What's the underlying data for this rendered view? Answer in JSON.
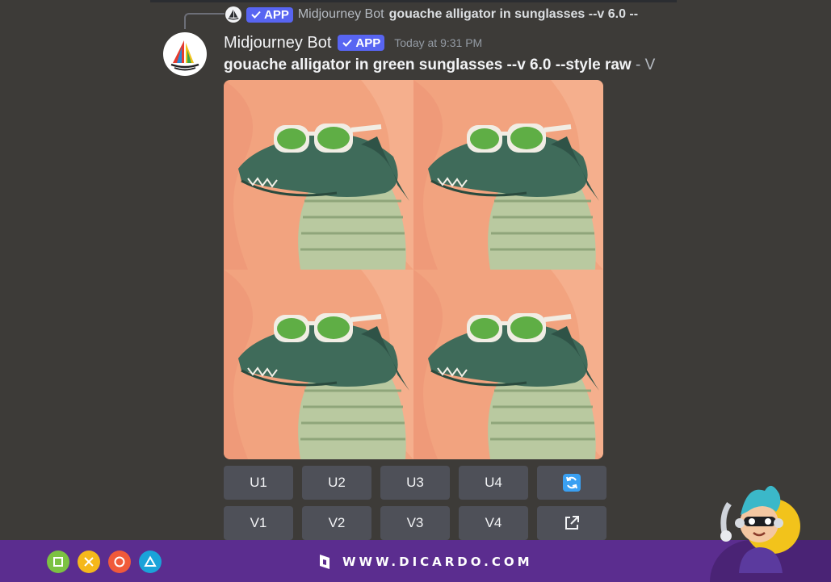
{
  "reply": {
    "bot_name": "Midjourney Bot",
    "badge": "APP",
    "prompt_excerpt": "gouache alligator in sunglasses --v 6.0 --"
  },
  "message": {
    "bot_name": "Midjourney Bot",
    "badge": "APP",
    "timestamp": "Today at 9:31 PM",
    "prompt": "gouache alligator in green sunglasses --v 6.0 --style raw",
    "prompt_rest": " - V"
  },
  "image_grid": {
    "tiles": [
      "image-1",
      "image-2",
      "image-3",
      "image-4"
    ],
    "colors": {
      "background": "#f2a37f",
      "lens": "#5fae45",
      "skin": "#3f6b5a"
    }
  },
  "buttons": {
    "upscale": [
      "U1",
      "U2",
      "U3",
      "U4"
    ],
    "variation": [
      "V1",
      "V2",
      "V3",
      "V4"
    ],
    "reroll_icon": "refresh-icon",
    "web_icon": "external-link-icon"
  },
  "footer": {
    "brand_text": "WWW.DICARDO.COM",
    "shape_icons": [
      "square-icon",
      "cross-icon",
      "circle-icon",
      "triangle-icon"
    ],
    "colors": {
      "bar": "#5b2d8f",
      "square": "#7cc242",
      "cross": "#f5b81b",
      "circle": "#f05a3a",
      "triangle": "#1aa3d9"
    }
  },
  "theme": {
    "bg": "#3d3b38",
    "button": "#4e5058",
    "badge": "#5865f2",
    "refresh": "#3aa0f2"
  }
}
